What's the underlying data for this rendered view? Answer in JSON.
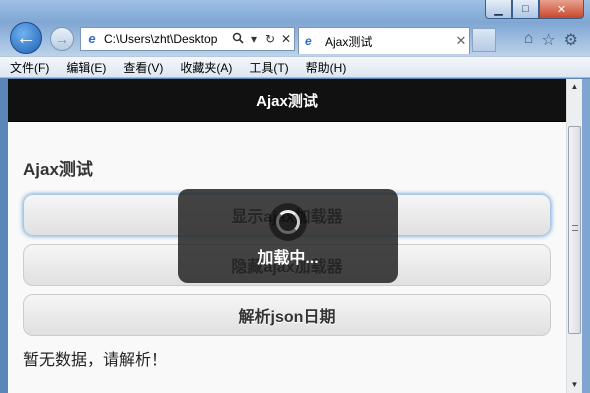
{
  "window": {
    "minimize": "▁",
    "maximize": "□",
    "close": "✕"
  },
  "nav": {
    "back": "🡐",
    "forward": "→"
  },
  "address": {
    "url": "C:\\Users\\zht\\Desktop",
    "search_icon": "search-icon",
    "dropdown_icon": "▾",
    "refresh_icon": "↻",
    "stop_icon": "✕"
  },
  "tab": {
    "title": "Ajax测试",
    "close": "✕"
  },
  "toolbar_icons": {
    "home": "⌂",
    "favorites": "☆",
    "settings": "⚙"
  },
  "menu": [
    "文件(F)",
    "编辑(E)",
    "查看(V)",
    "收藏夹(A)",
    "工具(T)",
    "帮助(H)"
  ],
  "page": {
    "header": "Ajax测试",
    "heading": "Ajax测试",
    "buttons": [
      "显示ajax加载器",
      "隐藏ajax加载器",
      "解析json日期"
    ],
    "result_text": "暂无数据，请解析！"
  },
  "loader": {
    "text": "加载中..."
  },
  "scrollbar": {
    "up": "▲",
    "down": "▼"
  },
  "colors": {
    "header_bg": "#111111",
    "loader_bg": "#232323",
    "focus_glow": "#5b9bd5"
  }
}
